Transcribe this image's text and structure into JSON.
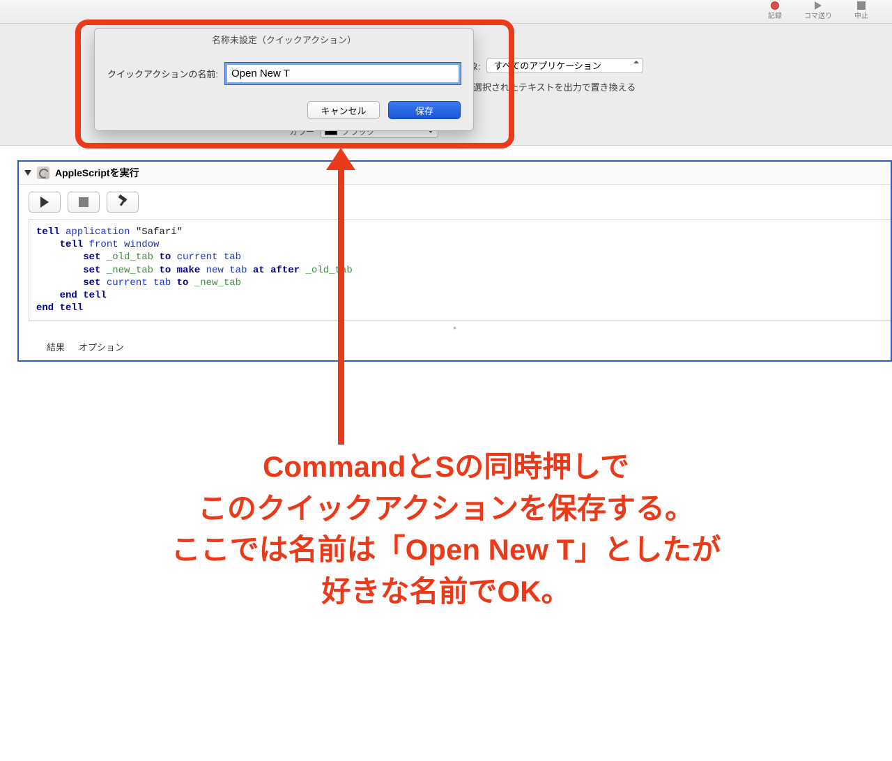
{
  "toolbar": {
    "record": "記録",
    "step": "コマ送り",
    "stop": "中止"
  },
  "options": {
    "target_label": "対象:",
    "target_value": "すべてのアプリケーション",
    "replace_text_label": "選択されたテキストを出力で置き換える",
    "color_label": "カラー",
    "color_value": "ブラック"
  },
  "dialog": {
    "title": "名称未設定（クイックアクション）",
    "name_label": "クイックアクションの名前:",
    "name_value": "Open New T",
    "cancel": "キャンセル",
    "save": "保存"
  },
  "action": {
    "title": "AppleScriptを実行",
    "code_lines": {
      "l1a": "tell",
      "l1b": " application ",
      "l1c": "\"Safari\"",
      "l2a": "    tell ",
      "l2b": "front window",
      "l3a": "        set ",
      "l3b": "_old_tab",
      "l3c": " to ",
      "l3d": "current tab",
      "l4a": "        set ",
      "l4b": "_new_tab",
      "l4c": " to ",
      "l4d": "make",
      "l4e": " new ",
      "l4f": "tab",
      "l4g": " at after ",
      "l4h": "_old_tab",
      "l5a": "        set ",
      "l5b": "current tab",
      "l5c": " to ",
      "l5d": "_new_tab",
      "l6": "    end tell",
      "l7": "end tell"
    },
    "footer_result": "結果",
    "footer_options": "オプション"
  },
  "annotation": {
    "line1": "CommandとSの同時押しで",
    "line2": "このクイックアクションを保存する。",
    "line3": "ここでは名前は「Open New T」としたが",
    "line4": "好きな名前でOK。"
  }
}
